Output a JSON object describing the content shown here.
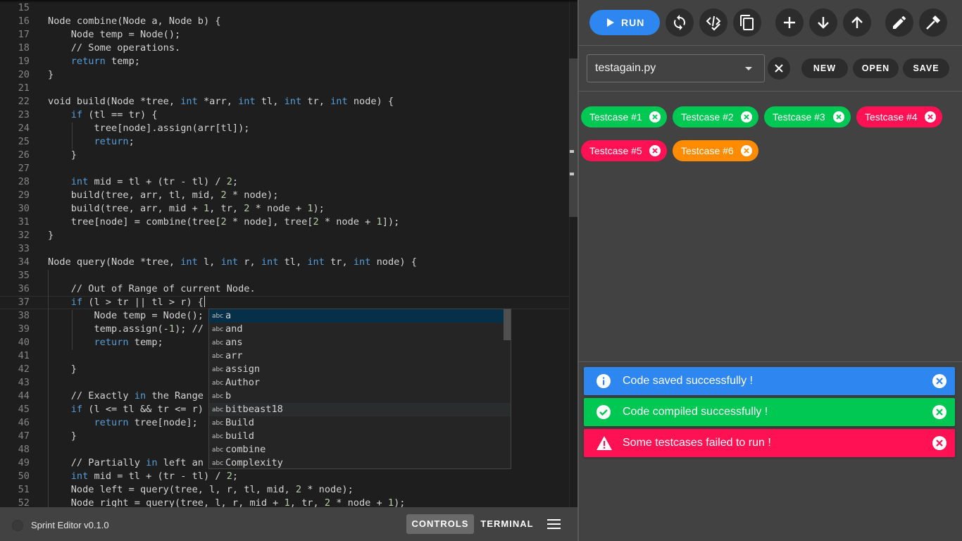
{
  "editor": {
    "current_line": 37,
    "lines": [
      {
        "n": "15",
        "html": ""
      },
      {
        "n": "16",
        "html": "Node combine(Node a, Node b) {"
      },
      {
        "n": "17",
        "html": "    Node temp = Node();"
      },
      {
        "n": "18",
        "html": "    // Some operations."
      },
      {
        "n": "19",
        "html": "    <span class=\"kw\">return</span> temp;"
      },
      {
        "n": "20",
        "html": "}"
      },
      {
        "n": "21",
        "html": ""
      },
      {
        "n": "22",
        "html": "void build(Node *tree, <span class=\"kw\">int</span> *arr, <span class=\"kw\">int</span> tl, <span class=\"kw\">int</span> tr, <span class=\"kw\">int</span> node) {"
      },
      {
        "n": "23",
        "html": "    <span class=\"kw\">if</span> (tl == tr) {"
      },
      {
        "n": "24",
        "html": "        tree[node].assign(arr[tl]);"
      },
      {
        "n": "25",
        "html": "        <span class=\"kw\">return</span>;"
      },
      {
        "n": "26",
        "html": "    }"
      },
      {
        "n": "27",
        "html": ""
      },
      {
        "n": "28",
        "html": "    <span class=\"kw\">int</span> mid = tl + (tr - tl) / <span class=\"num\">2</span>;"
      },
      {
        "n": "29",
        "html": "    build(tree, arr, tl, mid, <span class=\"num\">2</span> * node);"
      },
      {
        "n": "30",
        "html": "    build(tree, arr, mid + <span class=\"num\">1</span>, tr, <span class=\"num\">2</span> * node + <span class=\"num\">1</span>);"
      },
      {
        "n": "31",
        "html": "    tree[node] = combine(tree[<span class=\"num\">2</span> * node], tree[<span class=\"num\">2</span> * node + <span class=\"num\">1</span>]);"
      },
      {
        "n": "32",
        "html": "}"
      },
      {
        "n": "33",
        "html": ""
      },
      {
        "n": "34",
        "html": "Node query(Node *tree, <span class=\"kw\">int</span> l, <span class=\"kw\">int</span> r, <span class=\"kw\">int</span> tl, <span class=\"kw\">int</span> tr, <span class=\"kw\">int</span> node) {"
      },
      {
        "n": "35",
        "html": ""
      },
      {
        "n": "36",
        "html": "    // Out of Range of current Node."
      },
      {
        "n": "37",
        "html": "    <span class=\"kw\">if</span> (l > tr || tl > r) {<span class=\"caret\"></span>"
      },
      {
        "n": "38",
        "html": "        Node temp = Node();"
      },
      {
        "n": "39",
        "html": "        temp.assign(-<span class=\"num\">1</span>); //"
      },
      {
        "n": "40",
        "html": "        <span class=\"kw\">return</span> temp;"
      },
      {
        "n": "41",
        "html": ""
      },
      {
        "n": "42",
        "html": "    }"
      },
      {
        "n": "43",
        "html": ""
      },
      {
        "n": "44",
        "html": "    // Exactly <span class=\"kw\">in</span> the Range"
      },
      {
        "n": "45",
        "html": "    <span class=\"kw\">if</span> (l <= tl && tr <= r)"
      },
      {
        "n": "46",
        "html": "        <span class=\"kw\">return</span> tree[node];"
      },
      {
        "n": "47",
        "html": "    }"
      },
      {
        "n": "48",
        "html": ""
      },
      {
        "n": "49",
        "html": "    // Partially <span class=\"kw\">in</span> left an"
      },
      {
        "n": "50",
        "html": "    <span class=\"kw\">int</span> mid = tl + (tr - tl) / <span class=\"num\">2</span>;"
      },
      {
        "n": "51",
        "html": "    Node left = query(tree, l, r, tl, mid, <span class=\"num\">2</span> * node);"
      },
      {
        "n": "52",
        "html": "    Node right = query(tree, l, r, mid + <span class=\"num\">1</span>, tr, <span class=\"num\">2</span> * node + <span class=\"num\">1</span>);"
      }
    ]
  },
  "suggestions": {
    "icon_text": "abc",
    "selected_index": 0,
    "hover_index": 7,
    "items": [
      "a",
      "and",
      "ans",
      "arr",
      "assign",
      "Author",
      "b",
      "bitbeast18",
      "Build",
      "build",
      "combine",
      "Complexity"
    ]
  },
  "statusbar": {
    "app_name": "Sprint Editor v0.1.0",
    "controls_label": "CONTROLS",
    "terminal_label": "TERMINAL"
  },
  "toolbar": {
    "run_label": "RUN",
    "accent": "#2e86f0"
  },
  "file": {
    "selected": "testagain.py",
    "new_label": "NEW",
    "open_label": "OPEN",
    "save_label": "SAVE"
  },
  "testcases": [
    {
      "label": "Testcase #1",
      "status": "passed",
      "color": "#00c853"
    },
    {
      "label": "Testcase #2",
      "status": "passed",
      "color": "#00c853"
    },
    {
      "label": "Testcase #3",
      "status": "passed",
      "color": "#00c853"
    },
    {
      "label": "Testcase #4",
      "status": "failed",
      "color": "#ff1154"
    },
    {
      "label": "Testcase #5",
      "status": "failed",
      "color": "#ff1154"
    },
    {
      "label": "Testcase #6",
      "status": "warning",
      "color": "#ff8c00"
    }
  ],
  "notifications": [
    {
      "type": "info",
      "icon": "info-icon",
      "text": "Code saved successfully !",
      "color": "#2e86f0"
    },
    {
      "type": "success",
      "icon": "check-circle-icon",
      "text": "Code compiled successfully !",
      "color": "#00c853"
    },
    {
      "type": "error",
      "icon": "warning-icon",
      "text": "Some testcases failed to run !",
      "color": "#ff1154"
    }
  ]
}
